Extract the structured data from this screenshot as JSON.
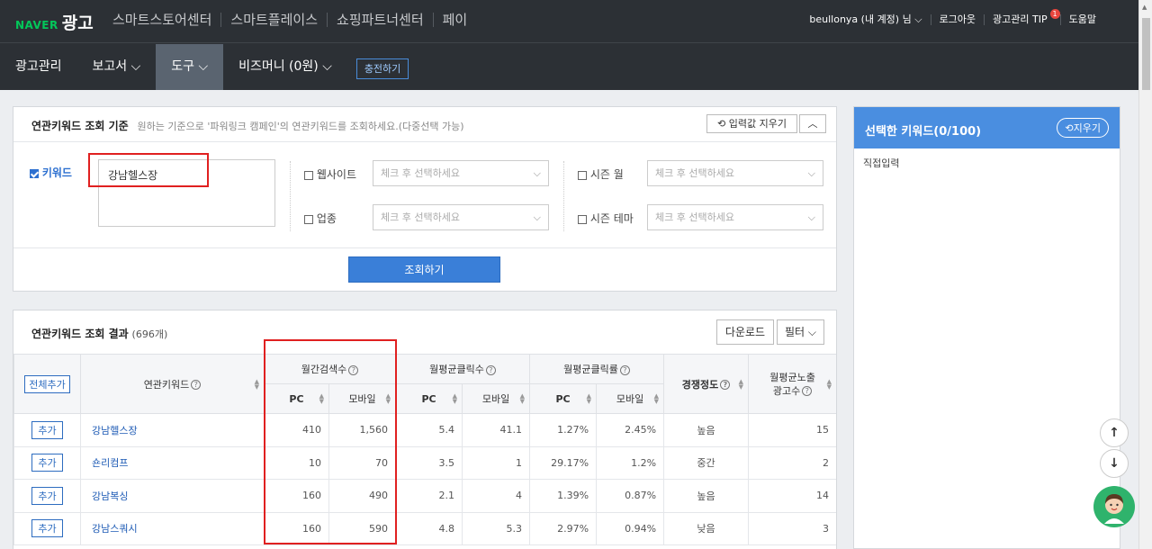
{
  "gnb": {
    "logo_naver": "NAVER",
    "logo_ad": "광고",
    "services": [
      "스마트스토어센터",
      "스마트플레이스",
      "쇼핑파트너센터",
      "페이"
    ],
    "user": "beullonya (내 계정) 님 ⌵",
    "logout": "로그아웃",
    "tip": "광고관리 TIP",
    "tip_badge": "1",
    "help": "도움말"
  },
  "menu": {
    "items": [
      "광고관리",
      "보고서 ⌵",
      "도구 ⌵",
      "비즈머니 (0원) ⌵"
    ],
    "charge": "충전하기"
  },
  "criteria": {
    "title": "연관키워드 조회 기준",
    "desc": "원하는 기준으로 '파워링크 캠페인'의 연관키워드를 조회하세요.(다중선택 가능)",
    "reset": "입력값 지우기",
    "keyword_label": "키워드",
    "keyword_value": "강남헬스장",
    "website_label": "웹사이트",
    "season_month_label": "시즌 월",
    "industry_label": "업종",
    "season_theme_label": "시즌 테마",
    "select_placeholder": "체크 후 선택하세요",
    "search_button": "조회하기"
  },
  "results": {
    "title": "연관키워드 조회 결과",
    "count": "(696개)",
    "download": "다운로드",
    "filter": "필터",
    "add_all": "전체추가",
    "col_keyword": "연관키워드",
    "col_monthly_search": "월간검색수",
    "col_avg_clicks": "월평균클릭수",
    "col_avg_ctr": "월평균클릭률",
    "col_competition": "경쟁정도",
    "col_avg_ads_1": "월평균노출",
    "col_avg_ads_2": "광고수",
    "sub_pc": "PC",
    "sub_mobile": "모바일",
    "add_label": "추가",
    "rows": [
      {
        "kw": "강남헬스장",
        "pc": "410",
        "mo": "1,560",
        "cpc": "5.4",
        "cmo": "41.1",
        "rpc": "1.27%",
        "rmo": "2.45%",
        "comp": "높음",
        "ads": "15"
      },
      {
        "kw": "숀리컴프",
        "pc": "10",
        "mo": "70",
        "cpc": "3.5",
        "cmo": "1",
        "rpc": "29.17%",
        "rmo": "1.2%",
        "comp": "중간",
        "ads": "2"
      },
      {
        "kw": "강남복싱",
        "pc": "160",
        "mo": "490",
        "cpc": "2.1",
        "cmo": "4",
        "rpc": "1.39%",
        "rmo": "0.87%",
        "comp": "높음",
        "ads": "14"
      },
      {
        "kw": "강남스쿼시",
        "pc": "160",
        "mo": "590",
        "cpc": "4.8",
        "cmo": "5.3",
        "rpc": "2.97%",
        "rmo": "0.94%",
        "comp": "낮음",
        "ads": "3"
      }
    ]
  },
  "side": {
    "title": "선택한 키워드(0/100)",
    "clear": "지우기",
    "direct": "직접입력"
  }
}
